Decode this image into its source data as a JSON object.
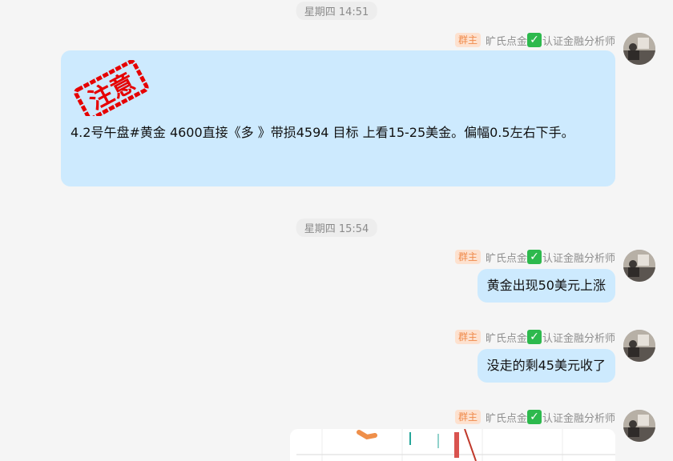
{
  "timestamps": [
    "星期四 14:51",
    "星期四 15:54"
  ],
  "sender": {
    "badge": "群主",
    "name_prefix": "旷氏点金",
    "verify_icon": "verified-check-icon",
    "name_suffix": "认证金融分析师"
  },
  "messages": [
    {
      "type": "image-text",
      "stamp_text": "注意",
      "text": "4.2号午盘#黄金 4600直接《多 》带损4594 目标    上看15-25美金。偏幅0.5左右下手。"
    },
    {
      "type": "text",
      "text": "黄金出现50美元上涨"
    },
    {
      "type": "text",
      "text": "没走的剩45美元收了"
    },
    {
      "type": "image",
      "description": "chart-thumbnail"
    }
  ],
  "colors": {
    "background": "#f5f5f5",
    "bubble": "#cdeafe",
    "badge_bg": "#fde1cf",
    "badge_text": "#f08a4b",
    "stamp_red": "#e60000"
  }
}
